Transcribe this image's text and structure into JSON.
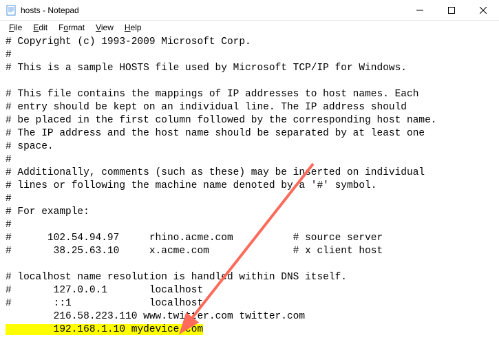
{
  "titlebar": {
    "title": "hosts - Notepad"
  },
  "menu": {
    "file": "File",
    "edit": "Edit",
    "format": "Format",
    "view": "View",
    "help": "Help"
  },
  "content": {
    "lines": [
      "# Copyright (c) 1993-2009 Microsoft Corp.",
      "#",
      "# This is a sample HOSTS file used by Microsoft TCP/IP for Windows.",
      "",
      "# This file contains the mappings of IP addresses to host names. Each",
      "# entry should be kept on an individual line. The IP address should",
      "# be placed in the first column followed by the corresponding host name.",
      "# The IP address and the host name should be separated by at least one",
      "# space.",
      "#",
      "# Additionally, comments (such as these) may be inserted on individual",
      "# lines or following the machine name denoted by a '#' symbol.",
      "#",
      "# For example:",
      "#",
      "#      102.54.94.97     rhino.acme.com          # source server",
      "#       38.25.63.10     x.acme.com              # x client host",
      "",
      "# localhost name resolution is handled within DNS itself.",
      "#\t127.0.0.1       localhost",
      "#\t::1             localhost",
      "\t216.58.223.110 www.twitter.com twitter.com"
    ],
    "highlighted_line": "\t192.168.1.10 mydevice.com"
  },
  "annotation": {
    "arrow_color": "#ff6b5b"
  }
}
